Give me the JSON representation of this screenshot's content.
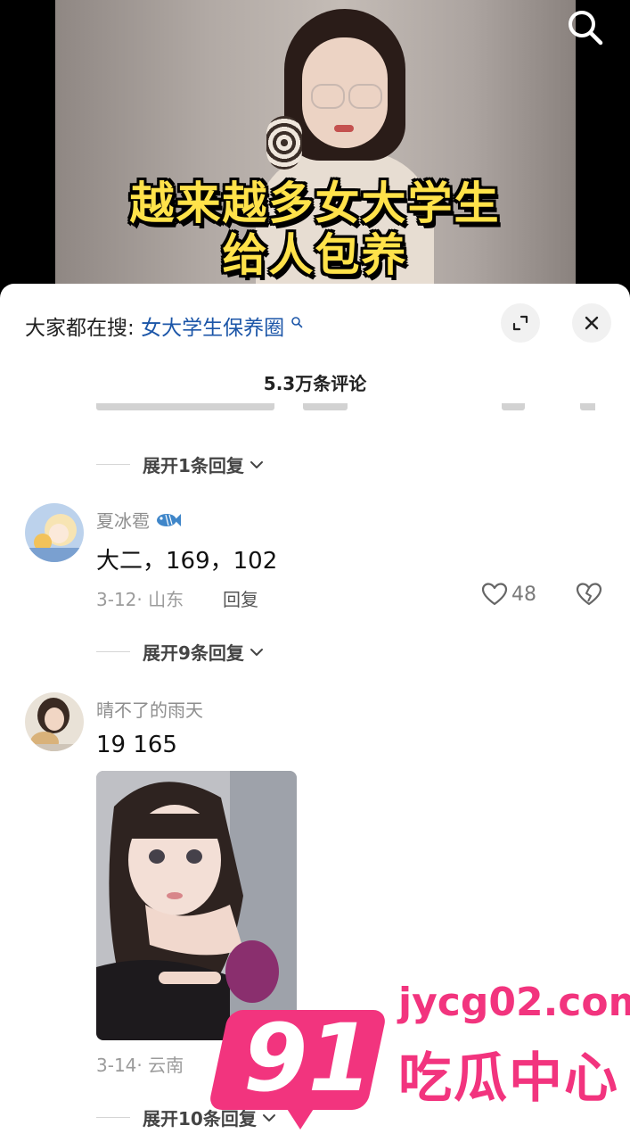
{
  "video": {
    "caption_line1": "越来越多女大学生",
    "caption_line2": "给人包养",
    "search_icon": "search-icon"
  },
  "panel": {
    "hot_search_label": "大家都在搜:",
    "hot_search_keyword": "女大学生保养圈",
    "comment_count": "5.3万条评论",
    "expand_icon": "expand-icon",
    "close_icon": "close-icon"
  },
  "comments": [
    {
      "expand_text": "展开1条回复"
    },
    {
      "username": "夏冰雹",
      "badge_icon": "fish-icon",
      "text": "大二，169，102",
      "meta": "3-12· 山东",
      "reply_label": "回复",
      "likes": "48",
      "expand_text": "展开9条回复"
    },
    {
      "username": "晴不了的雨天",
      "text": "19 165",
      "meta": "3-14· 云南",
      "reply_label": "回复",
      "expand_text": "展开10条回复"
    }
  ],
  "watermark": {
    "number": "91",
    "url": "jycg02.com",
    "name": "吃瓜中心"
  },
  "colors": {
    "keyword": "#1c56a8",
    "caption": "#ffe24a",
    "watermark": "#f2347e"
  }
}
